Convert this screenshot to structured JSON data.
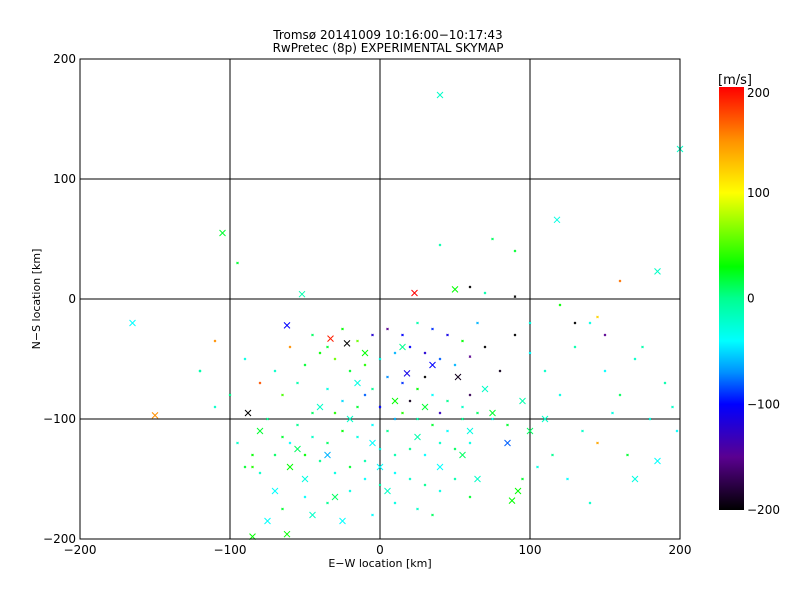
{
  "chart_data": {
    "type": "scatter",
    "title": "Tromsø 20141009  10:16:00−10:17:43",
    "subtitle": "RwPretec (8p) EXPERIMENTAL SKYMAP",
    "xlabel": "E−W location [km]",
    "ylabel": "N−S location [km]",
    "xlim": [
      -200,
      200
    ],
    "ylim": [
      -200,
      200
    ],
    "xticks": [
      -200,
      -100,
      0,
      100,
      200
    ],
    "yticks": [
      -200,
      -100,
      0,
      100,
      200
    ],
    "xtick_labels": [
      "−200",
      "−100",
      "0",
      "100",
      "200"
    ],
    "ytick_labels": [
      "−200",
      "−100",
      "0",
      "100",
      "200"
    ],
    "grid": true,
    "colorbar": {
      "label": "[m/s]",
      "range": [
        -200,
        200
      ],
      "ticks": [
        200,
        100,
        0,
        -100,
        -200
      ],
      "tick_labels": [
        "200",
        "100",
        "0",
        "−100",
        "−200"
      ],
      "stops": [
        {
          "v": -200,
          "color": "#000000"
        },
        {
          "v": -150,
          "color": "#5a0090"
        },
        {
          "v": -100,
          "color": "#0000ff"
        },
        {
          "v": -70,
          "color": "#0090ff"
        },
        {
          "v": -40,
          "color": "#00ffff"
        },
        {
          "v": 0,
          "color": "#00ff90"
        },
        {
          "v": 30,
          "color": "#00ff00"
        },
        {
          "v": 100,
          "color": "#ffff00"
        },
        {
          "v": 150,
          "color": "#ff9000"
        },
        {
          "v": 200,
          "color": "#ff0000"
        }
      ]
    },
    "points_format": [
      "x_km",
      "y_km",
      "velocity_ms",
      "large_marker"
    ],
    "points": [
      [
        -165,
        -20,
        -40,
        1
      ],
      [
        -105,
        55,
        20,
        1
      ],
      [
        40,
        170,
        -20,
        1
      ],
      [
        118,
        66,
        -30,
        1
      ],
      [
        185,
        23,
        -20,
        1
      ],
      [
        200,
        125,
        -20,
        1
      ],
      [
        -52,
        4,
        -10,
        1
      ],
      [
        23,
        5,
        200,
        1
      ],
      [
        -33,
        -33,
        190,
        1
      ],
      [
        -22,
        -37,
        -200,
        1
      ],
      [
        -62,
        -22,
        -100,
        1
      ],
      [
        -150,
        -97,
        150,
        1
      ],
      [
        -88,
        -95,
        -200,
        1
      ],
      [
        -85,
        -198,
        30,
        1
      ],
      [
        -62,
        -196,
        30,
        1
      ],
      [
        92,
        -160,
        30,
        1
      ],
      [
        88,
        -168,
        30,
        1
      ],
      [
        50,
        8,
        30,
        1
      ],
      [
        35,
        -55,
        -100,
        1
      ],
      [
        18,
        -62,
        -110,
        1
      ],
      [
        52,
        -65,
        -190,
        1
      ],
      [
        -40,
        -90,
        -20,
        1
      ],
      [
        -15,
        -70,
        -30,
        1
      ],
      [
        10,
        -85,
        30,
        1
      ],
      [
        30,
        -90,
        20,
        1
      ],
      [
        60,
        -110,
        -30,
        1
      ],
      [
        75,
        -95,
        20,
        1
      ],
      [
        -5,
        -120,
        -40,
        1
      ],
      [
        40,
        -140,
        -40,
        1
      ],
      [
        -50,
        -150,
        -30,
        1
      ],
      [
        -70,
        -160,
        -40,
        1
      ],
      [
        -25,
        -185,
        -40,
        1
      ],
      [
        5,
        -160,
        -20,
        1
      ],
      [
        -55,
        -125,
        10,
        1
      ],
      [
        -80,
        -110,
        20,
        1
      ],
      [
        -30,
        -165,
        10,
        1
      ],
      [
        70,
        -75,
        -20,
        1
      ],
      [
        95,
        -85,
        -10,
        1
      ],
      [
        110,
        -100,
        -20,
        1
      ],
      [
        170,
        -150,
        -30,
        1
      ],
      [
        185,
        -135,
        -40,
        1
      ],
      [
        -35,
        -130,
        -60,
        1
      ],
      [
        -10,
        -45,
        30,
        1
      ],
      [
        15,
        -40,
        0,
        1
      ],
      [
        -20,
        -100,
        -20,
        1
      ],
      [
        25,
        -115,
        -10,
        1
      ],
      [
        65,
        -150,
        -20,
        1
      ],
      [
        -45,
        -180,
        -20,
        1
      ],
      [
        -75,
        -185,
        -40,
        1
      ],
      [
        0,
        -140,
        -40,
        1
      ],
      [
        55,
        -130,
        10,
        1
      ],
      [
        85,
        -120,
        -80,
        1
      ],
      [
        100,
        -110,
        10,
        1
      ],
      [
        -60,
        -140,
        30,
        1
      ],
      [
        -20,
        -60,
        20,
        0
      ],
      [
        -10,
        -55,
        40,
        0
      ],
      [
        0,
        -50,
        -30,
        0
      ],
      [
        10,
        -45,
        -60,
        0
      ],
      [
        20,
        -40,
        -100,
        0
      ],
      [
        30,
        -45,
        -120,
        0
      ],
      [
        40,
        -50,
        -80,
        0
      ],
      [
        50,
        -55,
        -60,
        0
      ],
      [
        60,
        -48,
        -150,
        0
      ],
      [
        70,
        -40,
        -200,
        0
      ],
      [
        -30,
        -50,
        60,
        0
      ],
      [
        -40,
        -45,
        30,
        0
      ],
      [
        -50,
        -55,
        20,
        0
      ],
      [
        -60,
        -40,
        150,
        0
      ],
      [
        -70,
        -60,
        -20,
        0
      ],
      [
        -80,
        -70,
        170,
        0
      ],
      [
        -90,
        -50,
        -30,
        0
      ],
      [
        -100,
        -80,
        0,
        0
      ],
      [
        -110,
        -90,
        -20,
        0
      ],
      [
        -120,
        -60,
        -10,
        0
      ],
      [
        -95,
        -120,
        -20,
        0
      ],
      [
        -85,
        -130,
        30,
        0
      ],
      [
        -75,
        -100,
        0,
        0
      ],
      [
        -65,
        -80,
        50,
        0
      ],
      [
        -55,
        -70,
        -10,
        0
      ],
      [
        -45,
        -95,
        10,
        0
      ],
      [
        -35,
        -75,
        -30,
        0
      ],
      [
        -25,
        -85,
        -50,
        0
      ],
      [
        -15,
        -90,
        20,
        0
      ],
      [
        -5,
        -75,
        0,
        0
      ],
      [
        5,
        -65,
        -70,
        0
      ],
      [
        15,
        -70,
        -90,
        0
      ],
      [
        25,
        -75,
        30,
        0
      ],
      [
        35,
        -80,
        -40,
        0
      ],
      [
        45,
        -85,
        0,
        0
      ],
      [
        55,
        -90,
        -20,
        0
      ],
      [
        65,
        -95,
        10,
        0
      ],
      [
        75,
        -100,
        -30,
        0
      ],
      [
        85,
        -105,
        20,
        0
      ],
      [
        -5,
        -105,
        -40,
        0
      ],
      [
        5,
        -110,
        0,
        0
      ],
      [
        15,
        -95,
        40,
        0
      ],
      [
        25,
        -100,
        -10,
        0
      ],
      [
        35,
        -105,
        20,
        0
      ],
      [
        45,
        -110,
        -40,
        0
      ],
      [
        55,
        -100,
        0,
        0
      ],
      [
        -25,
        -110,
        30,
        0
      ],
      [
        -15,
        -115,
        -30,
        0
      ],
      [
        -45,
        -115,
        -20,
        0
      ],
      [
        -35,
        -120,
        10,
        0
      ],
      [
        -55,
        -105,
        0,
        0
      ],
      [
        -65,
        -115,
        20,
        0
      ],
      [
        0,
        -125,
        -30,
        0
      ],
      [
        10,
        -130,
        -10,
        0
      ],
      [
        20,
        -125,
        0,
        0
      ],
      [
        30,
        -130,
        -40,
        0
      ],
      [
        40,
        -120,
        -20,
        0
      ],
      [
        50,
        -125,
        10,
        0
      ],
      [
        60,
        -120,
        -30,
        0
      ],
      [
        -10,
        -135,
        -10,
        0
      ],
      [
        -20,
        -140,
        20,
        0
      ],
      [
        -30,
        -145,
        -30,
        0
      ],
      [
        -40,
        -135,
        0,
        0
      ],
      [
        -50,
        -130,
        30,
        0
      ],
      [
        -60,
        -120,
        -40,
        0
      ],
      [
        -70,
        -130,
        10,
        0
      ],
      [
        -80,
        -145,
        -20,
        0
      ],
      [
        -90,
        -140,
        20,
        0
      ],
      [
        -10,
        -150,
        -40,
        0
      ],
      [
        0,
        -155,
        -10,
        0
      ],
      [
        10,
        -145,
        -40,
        0
      ],
      [
        20,
        -150,
        -20,
        0
      ],
      [
        30,
        -155,
        0,
        0
      ],
      [
        40,
        -160,
        -30,
        0
      ],
      [
        50,
        -150,
        -10,
        0
      ],
      [
        60,
        -165,
        20,
        0
      ],
      [
        -20,
        -160,
        -30,
        0
      ],
      [
        -35,
        -170,
        0,
        0
      ],
      [
        -50,
        -165,
        -40,
        0
      ],
      [
        -65,
        -175,
        20,
        0
      ],
      [
        10,
        -170,
        -30,
        0
      ],
      [
        25,
        -175,
        -20,
        0
      ],
      [
        -5,
        -180,
        -40,
        0
      ],
      [
        35,
        -180,
        10,
        0
      ],
      [
        80,
        -60,
        -190,
        0
      ],
      [
        90,
        -30,
        -200,
        0
      ],
      [
        100,
        -45,
        -40,
        0
      ],
      [
        110,
        -60,
        -20,
        0
      ],
      [
        120,
        -80,
        -30,
        0
      ],
      [
        130,
        -40,
        -10,
        0
      ],
      [
        140,
        -20,
        -30,
        0
      ],
      [
        150,
        -60,
        -40,
        0
      ],
      [
        160,
        -80,
        10,
        0
      ],
      [
        170,
        -50,
        -20,
        0
      ],
      [
        180,
        -100,
        -30,
        0
      ],
      [
        190,
        -70,
        -10,
        0
      ],
      [
        135,
        -110,
        -20,
        0
      ],
      [
        145,
        -120,
        140,
        0
      ],
      [
        155,
        -95,
        -30,
        0
      ],
      [
        165,
        -130,
        20,
        0
      ],
      [
        125,
        -150,
        -40,
        0
      ],
      [
        140,
        -170,
        -20,
        0
      ],
      [
        115,
        -130,
        0,
        0
      ],
      [
        105,
        -140,
        -30,
        0
      ],
      [
        95,
        -150,
        20,
        0
      ],
      [
        130,
        -20,
        -200,
        0
      ],
      [
        145,
        -15,
        120,
        0
      ],
      [
        160,
        15,
        160,
        0
      ],
      [
        150,
        -30,
        -150,
        0
      ],
      [
        175,
        -40,
        -10,
        0
      ],
      [
        195,
        -90,
        -20,
        0
      ],
      [
        198,
        -110,
        -40,
        0
      ],
      [
        120,
        -5,
        30,
        0
      ],
      [
        90,
        40,
        20,
        0
      ],
      [
        75,
        50,
        10,
        0
      ],
      [
        40,
        45,
        -10,
        0
      ],
      [
        60,
        10,
        -200,
        0
      ],
      [
        70,
        5,
        -10,
        0
      ],
      [
        90,
        2,
        -200,
        0
      ],
      [
        100,
        -20,
        -30,
        0
      ],
      [
        -95,
        30,
        20,
        0
      ],
      [
        -120,
        -60,
        -10,
        0
      ],
      [
        -85,
        -140,
        40,
        0
      ],
      [
        -110,
        -35,
        150,
        0
      ],
      [
        -5,
        -30,
        -120,
        0
      ],
      [
        5,
        -25,
        -150,
        0
      ],
      [
        15,
        -30,
        -100,
        0
      ],
      [
        25,
        -20,
        -10,
        0
      ],
      [
        35,
        -25,
        -90,
        0
      ],
      [
        45,
        -30,
        -110,
        0
      ],
      [
        55,
        -35,
        30,
        0
      ],
      [
        65,
        -20,
        -60,
        0
      ],
      [
        -15,
        -35,
        60,
        0
      ],
      [
        -25,
        -25,
        30,
        0
      ],
      [
        -35,
        -40,
        20,
        0
      ],
      [
        -45,
        -30,
        10,
        0
      ],
      [
        0,
        -90,
        -100,
        0
      ],
      [
        20,
        -85,
        -190,
        0
      ],
      [
        40,
        -95,
        -130,
        0
      ],
      [
        60,
        -80,
        -170,
        0
      ],
      [
        -10,
        -80,
        -80,
        0
      ],
      [
        30,
        -65,
        -200,
        0
      ],
      [
        10,
        -100,
        -60,
        0
      ],
      [
        -30,
        -95,
        40,
        0
      ]
    ]
  }
}
